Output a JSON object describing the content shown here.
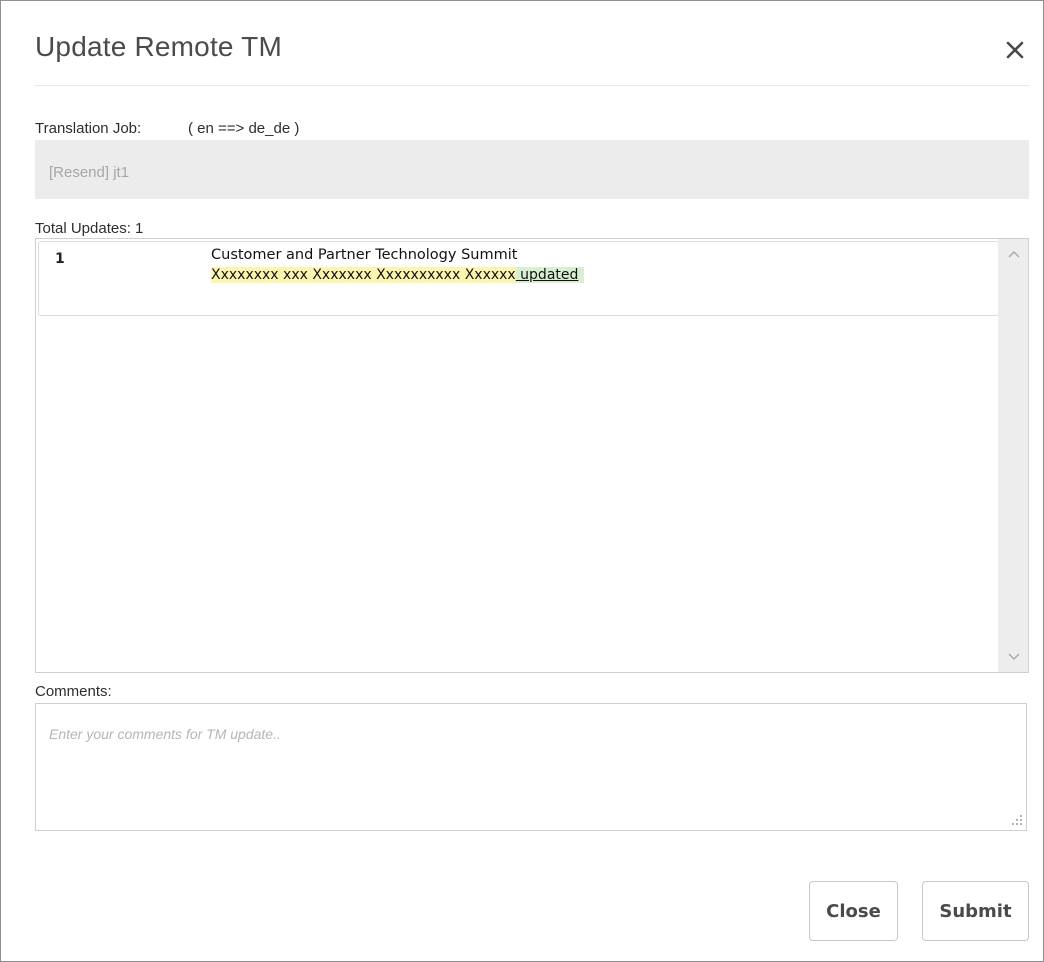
{
  "dialog": {
    "title": "Update Remote TM"
  },
  "job": {
    "label": "Translation Job:",
    "language_pair": "( en ==> de_de )",
    "value": "[Resend] jt1"
  },
  "updates": {
    "total_label": "Total Updates: 1",
    "items": [
      {
        "number": "1",
        "source": "Customer and Partner Technology Summit",
        "target_original": "Xxxxxxxx xxx Xxxxxxx Xxxxxxxxxx Xxxxxx",
        "target_added": " updated"
      }
    ]
  },
  "comments": {
    "label": "Comments:",
    "placeholder": "Enter your comments for TM update..",
    "value": ""
  },
  "buttons": {
    "close": "Close",
    "submit": "Submit"
  },
  "icons": {
    "close": "close-icon",
    "scroll_up": "chevron-up-icon",
    "scroll_down": "chevron-down-icon",
    "resize": "resize-grip-icon"
  },
  "colors": {
    "target_original_highlight": "#fcf5b0",
    "target_added_highlight": "#d8efd2",
    "job_field_background": "#ececec"
  }
}
